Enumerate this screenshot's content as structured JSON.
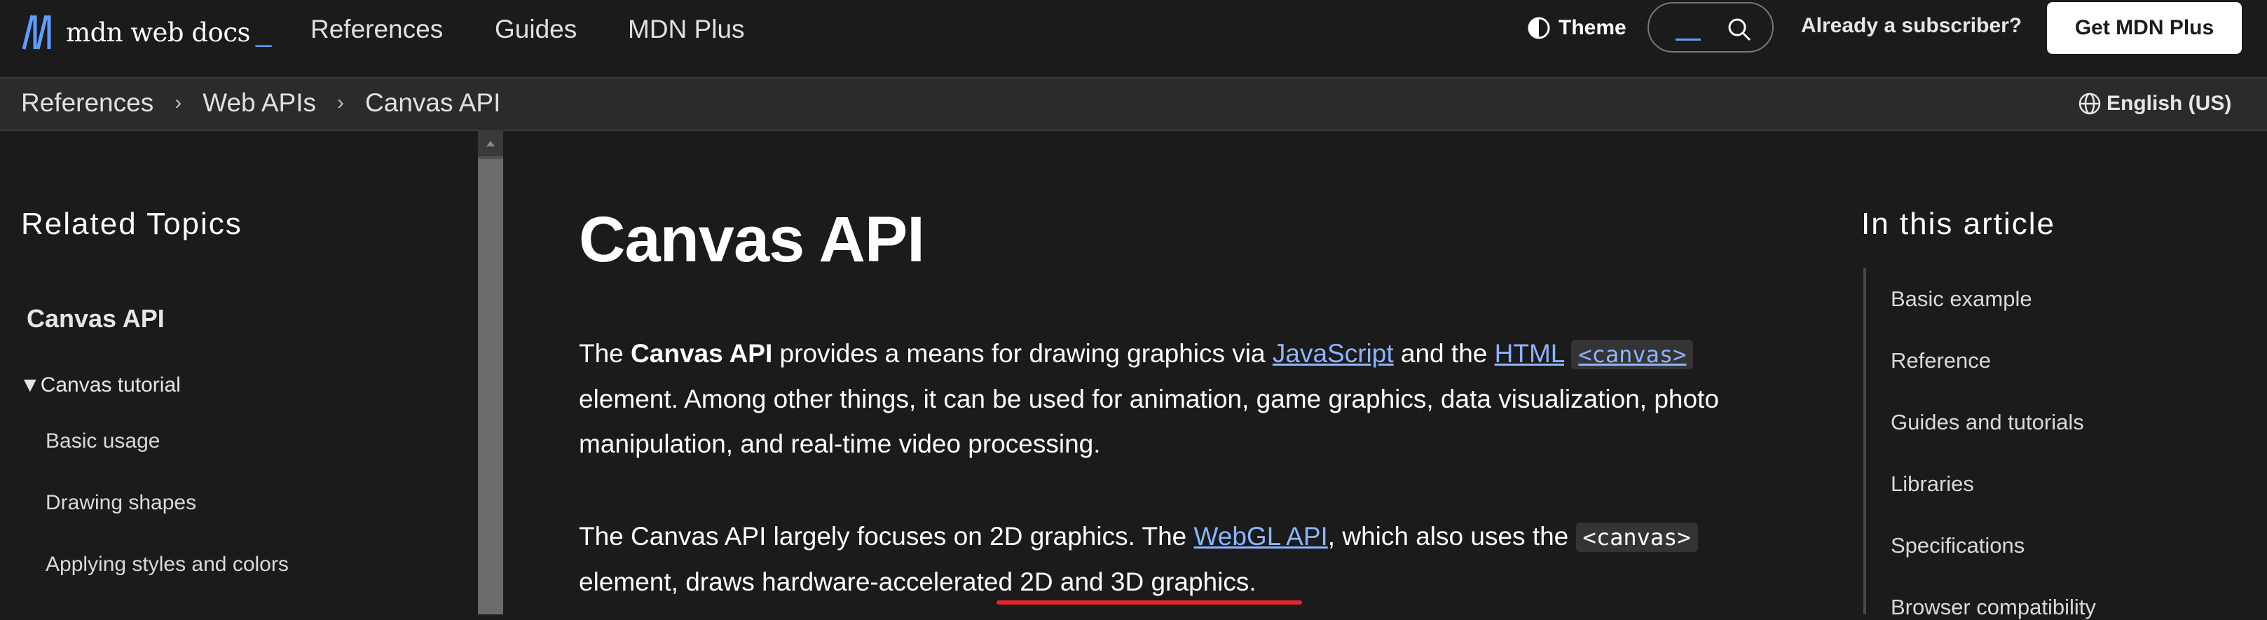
{
  "header": {
    "logo_text": "mdn web docs",
    "nav": [
      "References",
      "Guides",
      "MDN Plus"
    ],
    "theme_label": "Theme",
    "subscriber_label": "Already a subscriber?",
    "get_plus_label": "Get MDN Plus"
  },
  "breadcrumbs": [
    "References",
    "Web APIs",
    "Canvas API"
  ],
  "language": "English (US)",
  "sidebar": {
    "title": "Related Topics",
    "section": "Canvas API",
    "group": "▼Canvas tutorial",
    "items": [
      "Basic usage",
      "Drawing shapes",
      "Applying styles and colors"
    ]
  },
  "article": {
    "title": "Canvas API",
    "p1": {
      "t1": "The ",
      "bold": "Canvas API",
      "t2": " provides a means for drawing graphics via ",
      "link_js": "JavaScript",
      "t3": " and the ",
      "link_html": "HTML",
      "code": "<canvas>",
      "t4": " element. Among other things, it can be used for animation, game graphics, data visualization, photo manipulation, and real-time video processing."
    },
    "p2": {
      "t1": "The Canvas API largely focuses on 2D graphics. The ",
      "link_webgl": "WebGL API",
      "t2": ", which also uses the ",
      "code": "<canvas>",
      "t3": " element, draws hardware-accelerated 2D and 3D graphics."
    }
  },
  "toc": {
    "title": "In this article",
    "items": [
      "Basic example",
      "Reference",
      "Guides and tutorials",
      "Libraries",
      "Specifications",
      "Browser compatibility"
    ]
  },
  "colors": {
    "accent_link": "#8cb4ff",
    "logo_blue": "#5e9eff",
    "highlight_red": "#e8262a"
  }
}
